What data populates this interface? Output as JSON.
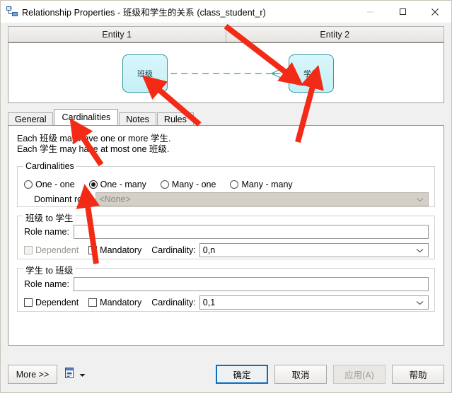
{
  "window": {
    "title": "Relationship Properties - 班级和学生的关系 (class_student_r)",
    "app_icon": "relationship-icon",
    "controls": {
      "minimize": "minimize-icon",
      "maximize": "maximize-icon",
      "close": "close-icon"
    }
  },
  "diagram": {
    "headers": [
      "Entity 1",
      "Entity 2"
    ],
    "entity1": "班级",
    "entity2": "学生",
    "link_style": "dashed",
    "link_color": "#2f9aa0",
    "entity_fill": "#cdf2f8",
    "entity_border": "#2f9aa0"
  },
  "tabs": [
    {
      "label": "General",
      "selected": false
    },
    {
      "label": "Cardinalities",
      "selected": true
    },
    {
      "label": "Notes",
      "selected": false
    },
    {
      "label": "Rules",
      "selected": false
    }
  ],
  "page": {
    "description_line1": "Each 班级 may have one or more 学生.",
    "description_line2": "Each 学生 may have at most one 班级.",
    "cardinalities": {
      "group_title": "Cardinalities",
      "options": [
        {
          "label": "One - one",
          "checked": false
        },
        {
          "label": "One - many",
          "checked": true
        },
        {
          "label": "Many - one",
          "checked": false
        },
        {
          "label": "Many - many",
          "checked": false
        }
      ],
      "dominant_role_label": "Dominant role:",
      "dominant_role_value": "<None>",
      "dominant_role_disabled": true
    },
    "class_to_student": {
      "group_title": "班级 to 学生",
      "role_name_label": "Role name:",
      "role_name_value": "",
      "dependent_label": "Dependent",
      "dependent_checked": false,
      "dependent_disabled": true,
      "mandatory_label": "Mandatory",
      "mandatory_checked": false,
      "cardinality_label": "Cardinality:",
      "cardinality_value": "0,n"
    },
    "student_to_class": {
      "group_title": "学生 to 班级",
      "role_name_label": "Role name:",
      "role_name_value": "",
      "dependent_label": "Dependent",
      "dependent_checked": false,
      "dependent_disabled": false,
      "mandatory_label": "Mandatory",
      "mandatory_checked": false,
      "cardinality_label": "Cardinality:",
      "cardinality_value": "0,1"
    }
  },
  "footer": {
    "more_label": "More >>",
    "print_icon": "report-icon",
    "print_dropdown_icon": "caret-down-icon",
    "ok_label": "确定",
    "cancel_label": "取消",
    "apply_label": "应用(A)",
    "apply_disabled": true,
    "help_label": "帮助",
    "default_button_color": "#0a6ebd"
  },
  "annotations": {
    "arrow_color": "#f22a16",
    "count": 4
  }
}
